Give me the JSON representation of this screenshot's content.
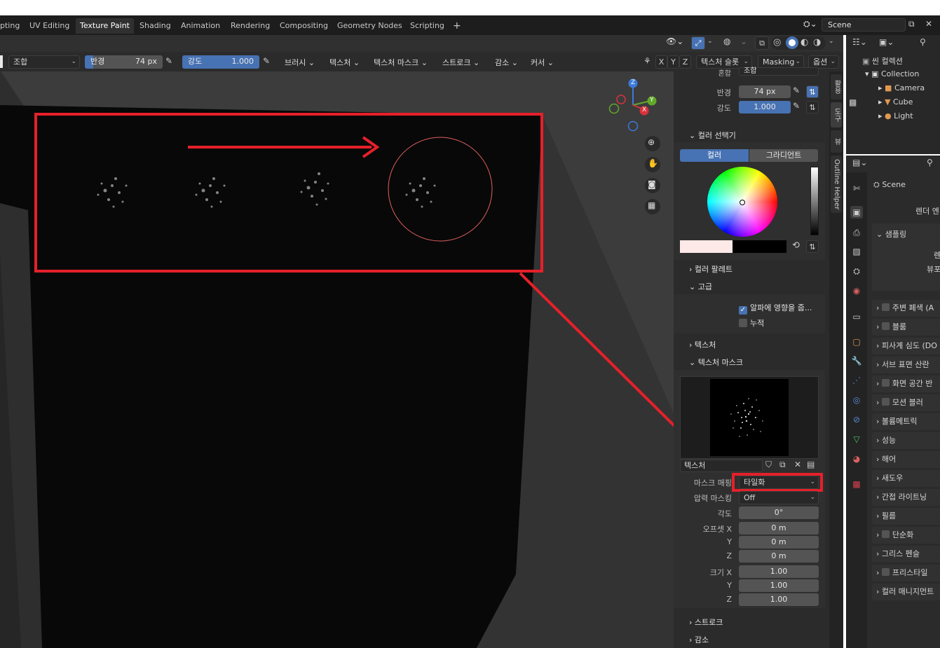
{
  "workspace_tabs": [
    "pting",
    "UV Editing",
    "Texture Paint",
    "Shading",
    "Animation",
    "Rendering",
    "Compositing",
    "Geometry Nodes",
    "Scripting",
    "+"
  ],
  "scene_name": "Scene",
  "tool_header": {
    "blend_mode": "조합",
    "radius_label": "반경",
    "radius_value": "74 px",
    "strength_label": "강도",
    "strength_value": "1.000",
    "menus": [
      "브러시",
      "텍스처",
      "텍스처 마스크",
      "스트로크",
      "감소",
      "커서"
    ],
    "axes": [
      "X",
      "Y",
      "Z"
    ],
    "texture_slot": "텍스처 슬롯",
    "masking": "Masking",
    "options": "옵션"
  },
  "npanel": {
    "blend_cut": "혼합",
    "blend_cut_value": "조합",
    "radius_label": "반경",
    "radius_value": "74 px",
    "strength_label": "강도",
    "strength_value": "1.000",
    "color_picker": "컬러 선택기",
    "tab_color": "컬러",
    "tab_gradient": "그라디언트",
    "color_palette": "컬러 팔레트",
    "advanced": "고급",
    "affect_alpha": "알파에 영향을 줍...",
    "accumulate": "누적",
    "texture": "텍스처",
    "texture_mask": "텍스처 마스크",
    "texture_field_label": "텍스처",
    "mask_mapping_label": "마스크 매핑",
    "mask_mapping_value": "타일화",
    "pressure_masking_label": "압력 마스킹",
    "pressure_masking_value": "Off",
    "angle_label": "각도",
    "angle_value": "0°",
    "offset_x_label": "오프셋 X",
    "y_label": "Y",
    "z_label": "Z",
    "offset_x": "0 m",
    "offset_y": "0 m",
    "offset_z": "0 m",
    "size_x_label": "크기 X",
    "size_x": "1.00",
    "size_y": "1.00",
    "size_z": "1.00",
    "stroke": "스트로크",
    "falloff": "감소"
  },
  "vertical_tabs": [
    "활용",
    "도구",
    "뷰",
    "Outline Helper"
  ],
  "outliner": {
    "scene_collection": "씬 컬렉션",
    "collection": "Collection",
    "items": [
      "Camera",
      "Cube",
      "Light"
    ]
  },
  "properties": {
    "scene": "Scene",
    "render_engine": "렌더 엔",
    "sampling": "샘플링",
    "sampling_sub1": "렌",
    "sampling_sub2": "뷰포",
    "sections": [
      "주변 폐색 (A",
      "블룸",
      "피사계 심도 (DO",
      "서브 표면 산란",
      "화면 공간 반",
      "모션 블러",
      "볼륨메트릭",
      "성능",
      "해어",
      "새도우",
      "간접 라이트닝",
      "필름",
      "단순화",
      "그리스 펜슬",
      "프리스타일",
      "컬러 매니지먼트"
    ],
    "sections_with_checkbox": [
      true,
      true,
      false,
      false,
      true,
      true,
      false,
      false,
      false,
      false,
      false,
      false,
      true,
      false,
      true,
      false
    ]
  },
  "gizmo_axes": [
    "Z",
    "Y",
    "X"
  ],
  "colors": {
    "accent_blue": "#4772b3",
    "highlight_red": "#e5202a"
  }
}
